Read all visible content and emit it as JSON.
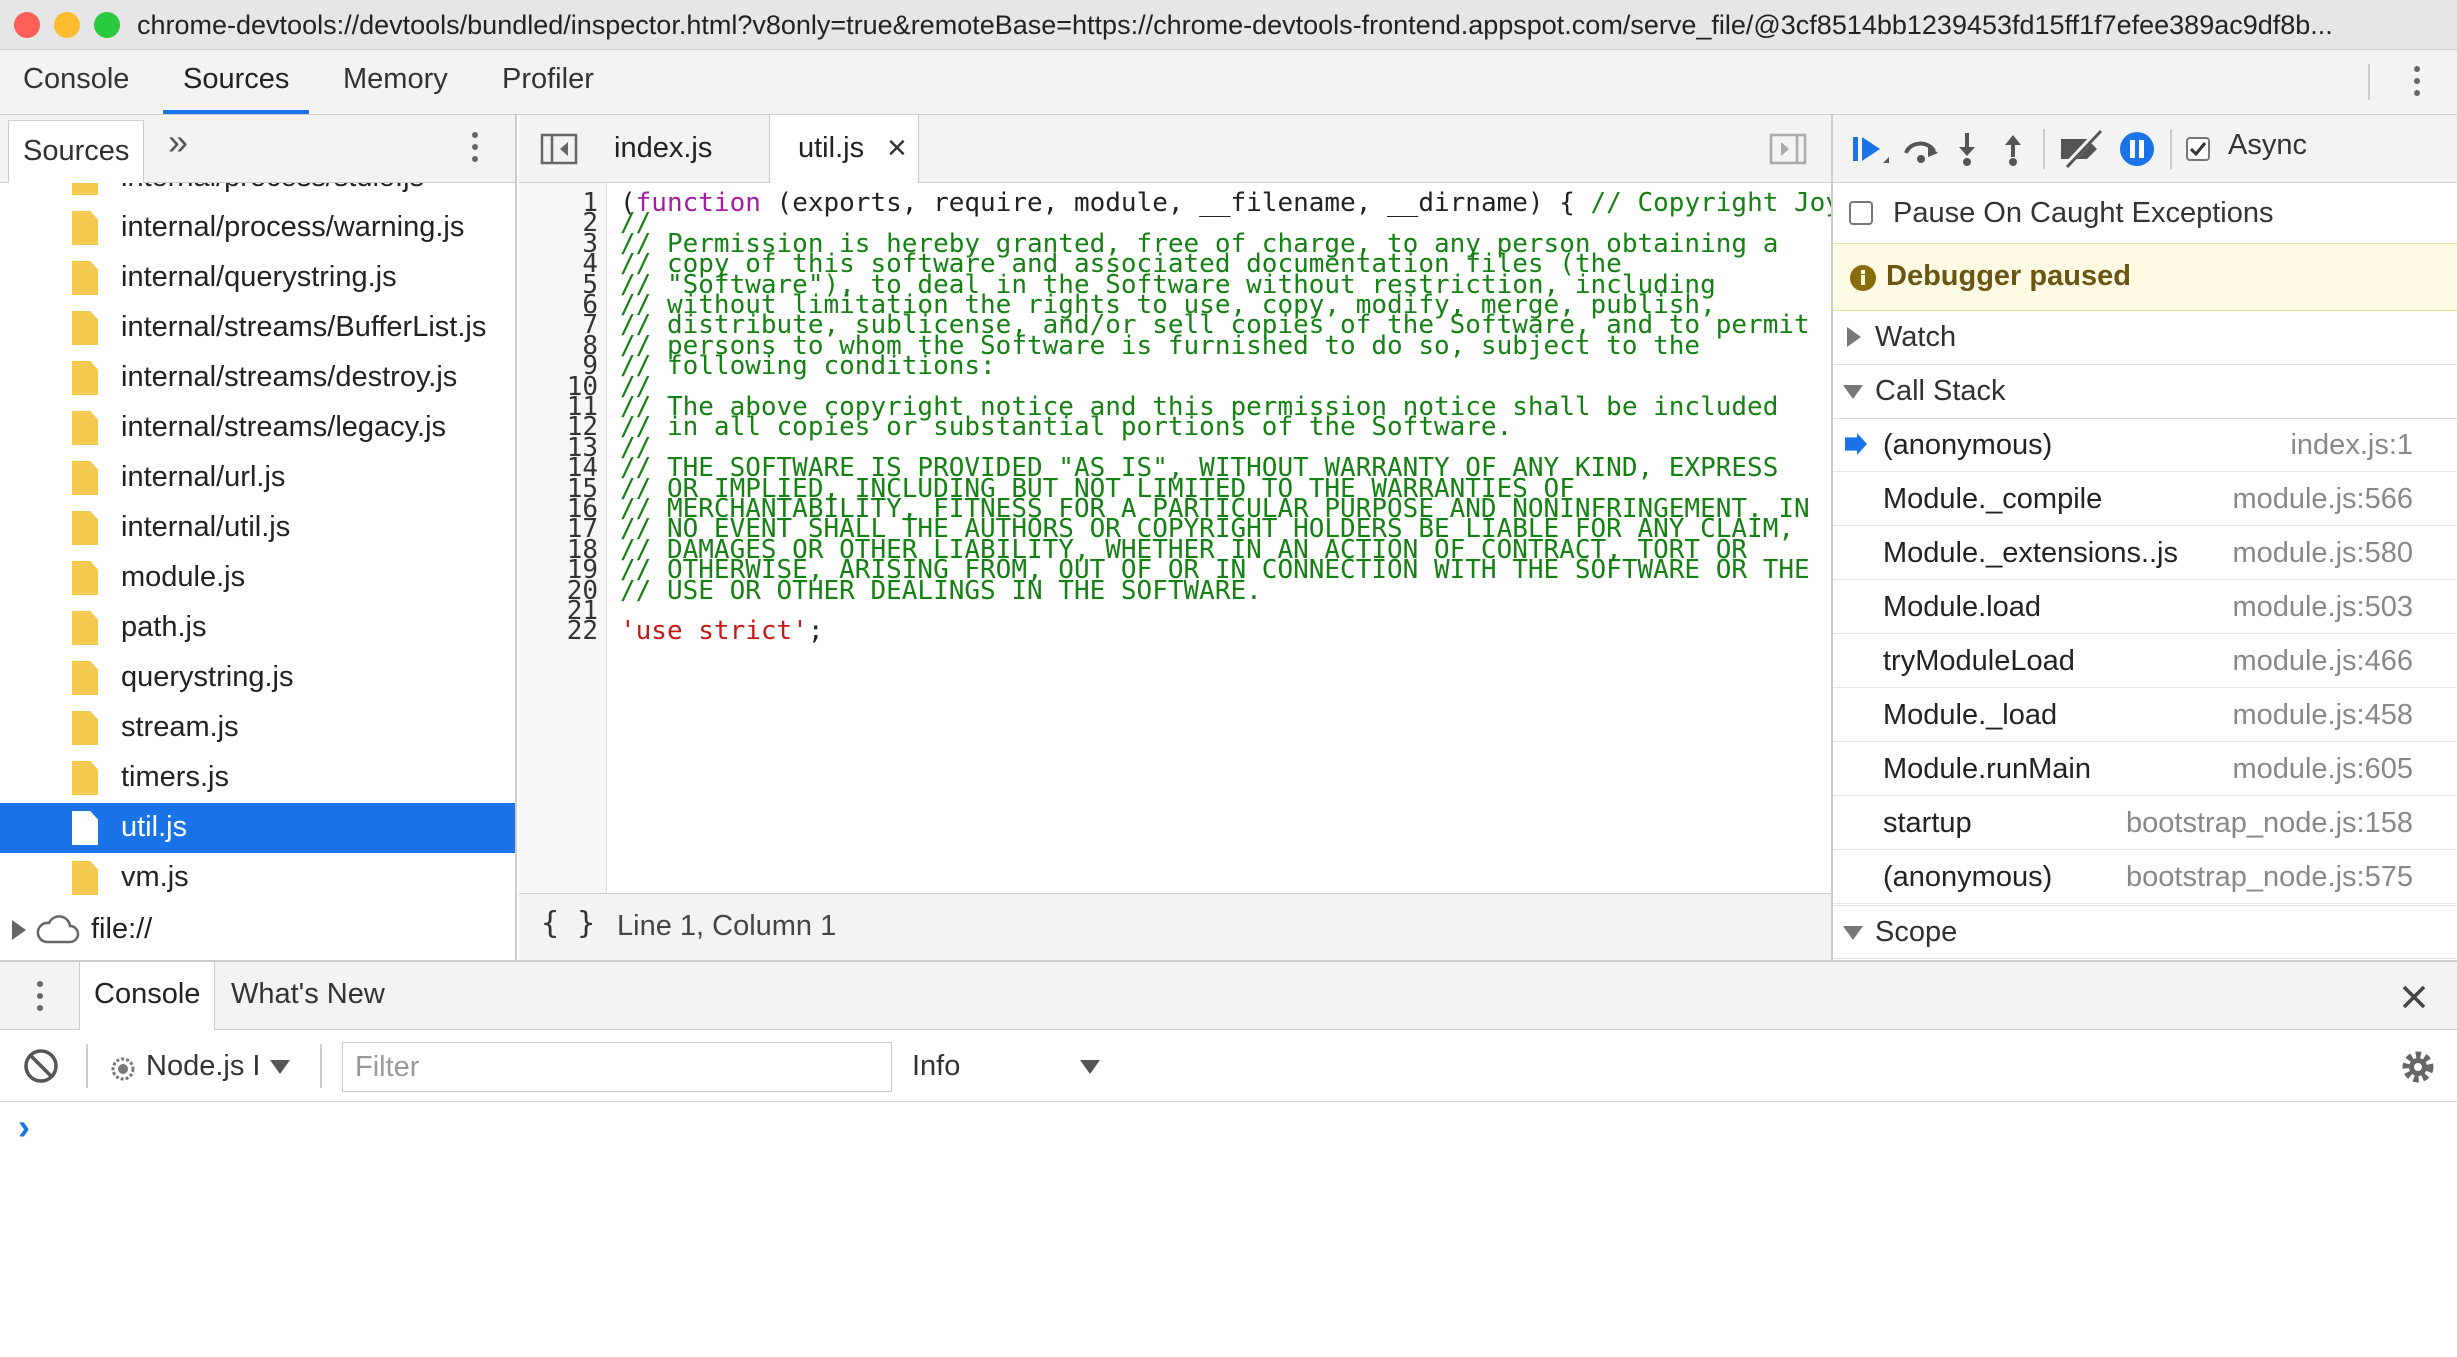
{
  "window": {
    "url": "chrome-devtools://devtools/bundled/inspector.html?v8only=true&remoteBase=https://chrome-devtools-frontend.appspot.com/serve_file/@3cf8514bb1239453fd15ff1f7efee389ac9df8b..."
  },
  "main_tabs": [
    "Console",
    "Sources",
    "Memory",
    "Profiler"
  ],
  "navigator": {
    "tab_label": "Sources",
    "more_glyph": "»",
    "partial_item": "internal/process/stdio.js",
    "files": [
      "internal/process/warning.js",
      "internal/querystring.js",
      "internal/streams/BufferList.js",
      "internal/streams/destroy.js",
      "internal/streams/legacy.js",
      "internal/url.js",
      "internal/util.js",
      "module.js",
      "path.js",
      "querystring.js",
      "stream.js",
      "timers.js",
      "util.js",
      "vm.js"
    ],
    "selected_file": "util.js",
    "origin_label": "file://"
  },
  "editor": {
    "tabs": [
      "index.js",
      "util.js"
    ],
    "active_tab": "util.js",
    "close_glyph": "×",
    "line_numbers": [
      "1",
      "2",
      "3",
      "4",
      "5",
      "6",
      "7",
      "8",
      "9",
      "10",
      "11",
      "12",
      "13",
      "14",
      "15",
      "16",
      "17",
      "18",
      "19",
      "20",
      "21",
      "22"
    ],
    "line1_keyword": "function",
    "line1_open": "(",
    "line1_rest": " (exports, require, module, __filename, __dirname) { ",
    "line1_comment": "// Copyright Joyent, Inc. and other Node contributors.",
    "comment_lines": [
      "//",
      "// Permission is hereby granted, free of charge, to any person obtaining a",
      "// copy of this software and associated documentation files (the",
      "// \"Software\"), to deal in the Software without restriction, including",
      "// without limitation the rights to use, copy, modify, merge, publish,",
      "// distribute, sublicense, and/or sell copies of the Software, and to permit",
      "// persons to whom the Software is furnished to do so, subject to the",
      "// following conditions:",
      "//",
      "// The above copyright notice and this permission notice shall be included",
      "// in all copies or substantial portions of the Software.",
      "//",
      "// THE SOFTWARE IS PROVIDED \"AS IS\", WITHOUT WARRANTY OF ANY KIND, EXPRESS",
      "// OR IMPLIED, INCLUDING BUT NOT LIMITED TO THE WARRANTIES OF",
      "// MERCHANTABILITY, FITNESS FOR A PARTICULAR PURPOSE AND NONINFRINGEMENT. IN",
      "// NO EVENT SHALL THE AUTHORS OR COPYRIGHT HOLDERS BE LIABLE FOR ANY CLAIM,",
      "// DAMAGES OR OTHER LIABILITY, WHETHER IN AN ACTION OF CONTRACT, TORT OR",
      "// OTHERWISE, ARISING FROM, OUT OF OR IN CONNECTION WITH THE SOFTWARE OR THE",
      "// USE OR OTHER DEALINGS IN THE SOFTWARE."
    ],
    "line21": "",
    "line22_string": "'use strict'",
    "line22_end": ";",
    "status_braces": "{ }",
    "cursor_position": "Line 1, Column 1"
  },
  "debugger": {
    "async_label": "Async",
    "pause_caught_label": "Pause On Caught Exceptions",
    "paused_message": "Debugger paused",
    "watch_label": "Watch",
    "call_stack_label": "Call Stack",
    "scope_label": "Scope",
    "call_stack": [
      {
        "fn": "(anonymous)",
        "loc": "index.js:1"
      },
      {
        "fn": "Module._compile",
        "loc": "module.js:566"
      },
      {
        "fn": "Module._extensions..js",
        "loc": "module.js:580"
      },
      {
        "fn": "Module.load",
        "loc": "module.js:503"
      },
      {
        "fn": "tryModuleLoad",
        "loc": "module.js:466"
      },
      {
        "fn": "Module._load",
        "loc": "module.js:458"
      },
      {
        "fn": "Module.runMain",
        "loc": "module.js:605"
      },
      {
        "fn": "startup",
        "loc": "bootstrap_node.js:158"
      },
      {
        "fn": "(anonymous)",
        "loc": "bootstrap_node.js:575"
      }
    ]
  },
  "drawer": {
    "tabs": [
      "Console",
      "What's New"
    ],
    "context_label": "Node.js I",
    "filter_placeholder": "Filter",
    "level_label": "Info",
    "prompt_glyph": "›"
  },
  "colors": {
    "accent": "#1a73e8",
    "comment": "#168015",
    "keyword": "#a41ea2",
    "string": "#c41a16",
    "paused_bg": "#fffbe5",
    "file_icon": "#f3c94f"
  }
}
